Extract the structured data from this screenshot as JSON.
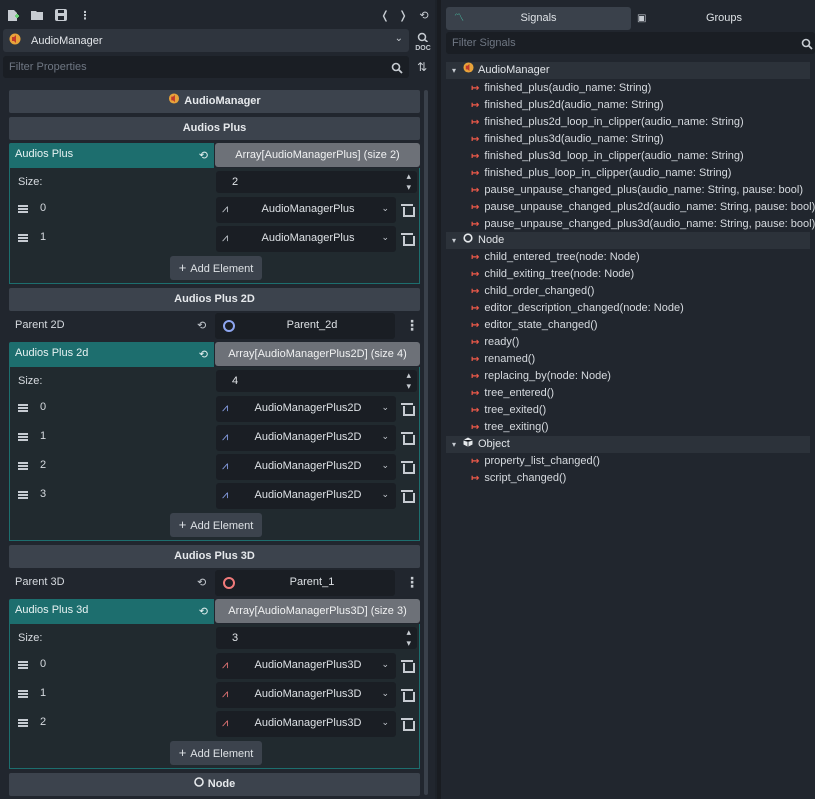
{
  "inspector": {
    "node_name": "AudioManager",
    "filter_placeholder": "Filter Properties",
    "section_title": "AudioManager",
    "groups": {
      "plus": {
        "title": "Audios Plus",
        "prop_label": "Audios Plus",
        "array_label": "Array[AudioManagerPlus] (size 2)",
        "size_label": "Size:",
        "size": "2",
        "elements": [
          {
            "index": "0",
            "name": "AudioManagerPlus"
          },
          {
            "index": "1",
            "name": "AudioManagerPlus"
          }
        ],
        "add_label": "Add Element"
      },
      "plus2d": {
        "title": "Audios Plus 2D",
        "parent_label": "Parent 2D",
        "parent_value": "Parent_2d",
        "prop_label": "Audios Plus 2d",
        "array_label": "Array[AudioManagerPlus2D] (size 4)",
        "size_label": "Size:",
        "size": "4",
        "elements": [
          {
            "index": "0",
            "name": "AudioManagerPlus2D"
          },
          {
            "index": "1",
            "name": "AudioManagerPlus2D"
          },
          {
            "index": "2",
            "name": "AudioManagerPlus2D"
          },
          {
            "index": "3",
            "name": "AudioManagerPlus2D"
          }
        ],
        "add_label": "Add Element"
      },
      "plus3d": {
        "title": "Audios Plus 3D",
        "parent_label": "Parent 3D",
        "parent_value": "Parent_1",
        "prop_label": "Audios Plus 3d",
        "array_label": "Array[AudioManagerPlus3D] (size 3)",
        "size_label": "Size:",
        "size": "3",
        "elements": [
          {
            "index": "0",
            "name": "AudioManagerPlus3D"
          },
          {
            "index": "1",
            "name": "AudioManagerPlus3D"
          },
          {
            "index": "2",
            "name": "AudioManagerPlus3D"
          }
        ],
        "add_label": "Add Element"
      }
    },
    "node_section_title": "Node",
    "doc_label": "DOC"
  },
  "dock": {
    "tabs": [
      "Signals",
      "Groups"
    ],
    "filter_placeholder": "Filter Signals",
    "categories": [
      {
        "name": "AudioManager",
        "signals": [
          "finished_plus(audio_name: String)",
          "finished_plus2d(audio_name: String)",
          "finished_plus2d_loop_in_clipper(audio_name: String)",
          "finished_plus3d(audio_name: String)",
          "finished_plus3d_loop_in_clipper(audio_name: String)",
          "finished_plus_loop_in_clipper(audio_name: String)",
          "pause_unpause_changed_plus(audio_name: String, pause: bool)",
          "pause_unpause_changed_plus2d(audio_name: String, pause: bool)",
          "pause_unpause_changed_plus3d(audio_name: String, pause: bool)"
        ]
      },
      {
        "name": "Node",
        "signals": [
          "child_entered_tree(node: Node)",
          "child_exiting_tree(node: Node)",
          "child_order_changed()",
          "editor_description_changed(node: Node)",
          "editor_state_changed()",
          "ready()",
          "renamed()",
          "replacing_by(node: Node)",
          "tree_entered()",
          "tree_exited()",
          "tree_exiting()"
        ]
      },
      {
        "name": "Object",
        "signals": [
          "property_list_changed()",
          "script_changed()"
        ]
      }
    ]
  },
  "colors": {
    "accent_teal": "#1d6e6e",
    "signal_red": "#f05a4a",
    "plus_icon": "#c7ccd2",
    "plus2d_icon": "#8ea6f0",
    "plus3d_icon": "#f07a7a",
    "node2d_circle": "#8ea6f0",
    "node3d_circle": "#f07a7a"
  }
}
